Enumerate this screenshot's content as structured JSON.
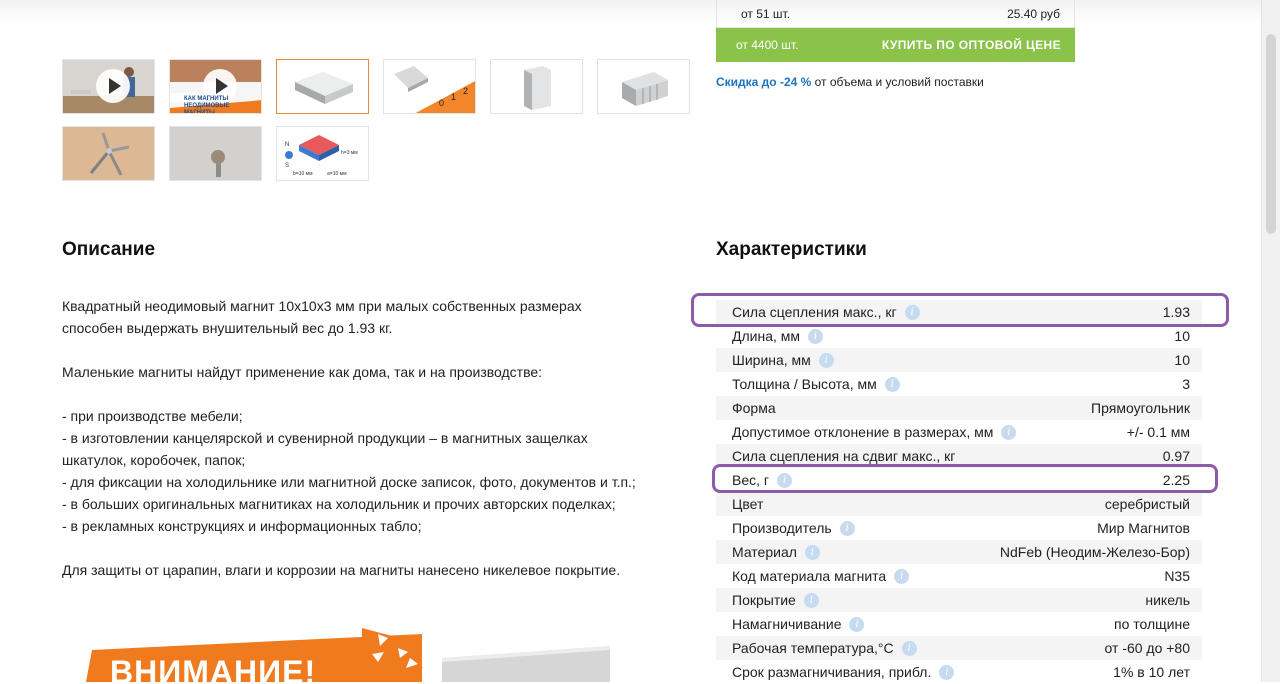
{
  "pricing": {
    "row": {
      "qty": "от 51 шт.",
      "price": "25.40 руб"
    },
    "wholesale": {
      "qty": "от 4400 шт.",
      "buy_label": "КУПИТЬ ПО ОПТОВОЙ ЦЕНЕ"
    },
    "discount": {
      "label": "Скидка до -24 %",
      "text": " от объема и условий поставки"
    }
  },
  "gallery": {
    "video2_caption": "КАК МАГНИТЫ НЕОДИМОВЫЕ МАГНИТЫ",
    "ruler_numbers": [
      "0",
      "1",
      "2"
    ],
    "diagram": {
      "width": "b=10 мм",
      "length": "a=10 мм",
      "height": "h=3 мм"
    }
  },
  "description": {
    "title": "Описание",
    "paragraphs": [
      "Квадратный неодимовый магнит 10x10x3 мм при малых собственных размерах способен выдержать внушительный вес до 1.93 кг.",
      "Маленькие магниты найдут применение как дома, так и на производстве:",
      "- при производстве мебели;",
      "- в изготовлении канцелярской и сувенирной продукции – в магнитных защелках шкатулок, коробочек, папок;",
      "- для фиксации на холодильнике или магнитной доске записок, фото, документов и т.п.;",
      "- в больших оригинальных магнитиках на холодильник и прочих авторских поделках;",
      "- в рекламных конструкциях и информационных табло;",
      "Для защиты от царапин, влаги и коррозии на магниты нанесено никелевое покрытие."
    ],
    "banner_text": "ВНИМАНИЕ!"
  },
  "specs": {
    "title": "Характеристики",
    "info_glyph": "i",
    "rows": [
      {
        "name": "Сила сцепления макс., кг",
        "value": "1.93",
        "info": true
      },
      {
        "name": "Длина, мм",
        "value": "10",
        "info": true
      },
      {
        "name": "Ширина, мм",
        "value": "10",
        "info": true
      },
      {
        "name": "Толщина / Высота, мм",
        "value": "3",
        "info": true
      },
      {
        "name": "Форма",
        "value": "Прямоугольник",
        "info": false
      },
      {
        "name": "Допустимое отклонение в размерах, мм",
        "value": "+/- 0.1 мм",
        "info": true
      },
      {
        "name": "Сила сцепления на сдвиг макс., кг",
        "value": "0.97",
        "info": false
      },
      {
        "name": "Вес, г",
        "value": "2.25",
        "info": true
      },
      {
        "name": "Цвет",
        "value": "серебристый",
        "info": false
      },
      {
        "name": "Производитель",
        "value": "Мир Магнитов",
        "info": true
      },
      {
        "name": "Материал",
        "value": "NdFeb (Неодим-Железо-Бор)",
        "info": true
      },
      {
        "name": "Код материала магнита",
        "value": "N35",
        "info": true
      },
      {
        "name": "Покрытие",
        "value": "никель",
        "info": true
      },
      {
        "name": "Намагничивание",
        "value": "по толщине",
        "info": true
      },
      {
        "name": "Рабочая температура,°C",
        "value": "от -60 до +80",
        "info": true
      },
      {
        "name": "Срок размагничивания, прибл.",
        "value": "1% в 10 лет",
        "info": true
      }
    ]
  },
  "colors": {
    "accent_green": "#8bc34a",
    "link_blue": "#1e73be",
    "highlight_purple": "#8e5ba8",
    "banner_orange": "#f07a1e"
  }
}
